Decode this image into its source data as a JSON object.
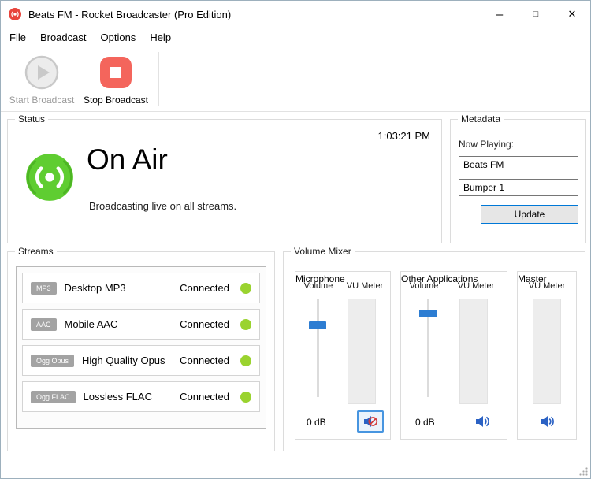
{
  "window": {
    "title": "Beats FM - Rocket Broadcaster (Pro Edition)"
  },
  "titlebar": {
    "minimize": "–",
    "maximize": "□",
    "close": "✕"
  },
  "menu": {
    "items": [
      "File",
      "Broadcast",
      "Options",
      "Help"
    ]
  },
  "toolbar": {
    "start_label": "Start Broadcast",
    "stop_label": "Stop Broadcast"
  },
  "status": {
    "group_label": "Status",
    "clock": "1:03:21 PM",
    "headline": "On Air",
    "subtext": "Broadcasting live on all streams."
  },
  "metadata": {
    "group_label": "Metadata",
    "now_playing_label": "Now Playing:",
    "field1": "Beats FM",
    "field2": "Bumper 1",
    "update_label": "Update"
  },
  "streams": {
    "group_label": "Streams",
    "items": [
      {
        "badge": "MP3",
        "name": "Desktop MP3",
        "status": "Connected"
      },
      {
        "badge": "AAC",
        "name": "Mobile AAC",
        "status": "Connected"
      },
      {
        "badge": "Ogg Opus",
        "name": "High Quality Opus",
        "status": "Connected"
      },
      {
        "badge": "Ogg FLAC",
        "name": "Lossless FLAC",
        "status": "Connected"
      }
    ]
  },
  "mixer": {
    "group_label": "Volume Mixer",
    "microphone": {
      "label": "Microphone",
      "volume_label": "Volume",
      "vu_label": "VU Meter",
      "db": "0 dB",
      "volume_percent": 75,
      "muted": true
    },
    "other": {
      "label": "Other Applications",
      "volume_label": "Volume",
      "vu_label": "VU Meter",
      "db": "0 dB",
      "volume_percent": 88,
      "muted": false
    },
    "master": {
      "label": "Master",
      "vu_label": "VU Meter",
      "muted": false
    }
  },
  "colors": {
    "accent_blue": "#0078d7",
    "slider_blue": "#2d7dd2",
    "on_air_green": "#5fcd31",
    "connected_green": "#9ad32f",
    "stop_red": "#f4655c",
    "speaker_blue": "#2b62c4",
    "mute_red": "#d23b3b"
  }
}
